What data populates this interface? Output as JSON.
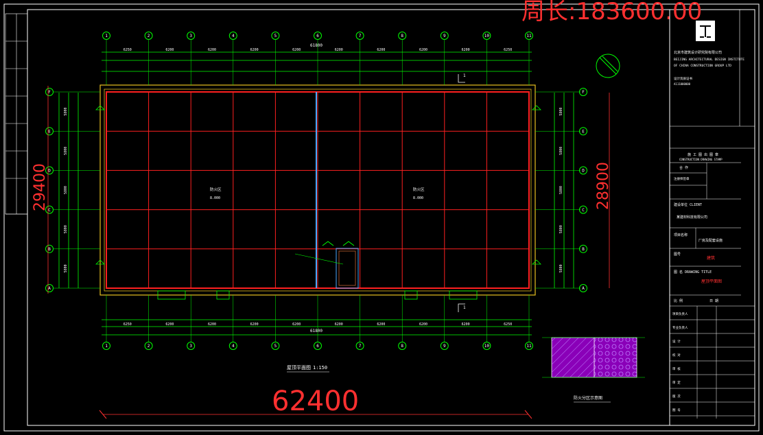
{
  "drawing": {
    "perimeter_label": "周长:183600.00",
    "overall_width": "62400",
    "left_height": "29400",
    "right_height": "28900",
    "total_span_top": "61800",
    "total_span_bottom": "61800",
    "plan_title": "屋顶平面图",
    "plan_scale": "1:150",
    "detail_title": "防火分区示意图",
    "axes_columns": [
      "1",
      "2",
      "3",
      "4",
      "5",
      "6",
      "7",
      "8",
      "9",
      "10",
      "11"
    ],
    "axes_rows": [
      "F",
      "E",
      "D",
      "C",
      "B",
      "A"
    ],
    "bay_labels_top": [
      "6250",
      "6200",
      "6200",
      "6200",
      "6200",
      "6200",
      "6200",
      "6200",
      "6200",
      "6250"
    ],
    "row_dims_left": [
      "5800",
      "5800",
      "5800",
      "5800",
      "5800"
    ],
    "row_dims_right": [
      "5800",
      "5800",
      "5800",
      "5800",
      "5800"
    ],
    "zone_label_left": "防火区",
    "zone_label_right": "防火区",
    "level_left": "8.000",
    "level_right": "8.000",
    "section_mark": "1"
  },
  "title_block": {
    "company": "北京市建筑设计研究院有限公司",
    "company_en_1": "BEIJING ARCHITECTURAL DESIGN INSTITUTE",
    "company_en_2": "OF CHINA CONSTRUCTION GROUP LTD",
    "cert": "设计资质证书",
    "cert_no": "A111000000",
    "stamp_title": "施 工 图 出 图 章",
    "stamp_en": "CONSTRUCTION DRAWING STAMP",
    "cell_a": "合 作",
    "cell_b": "注册师签章",
    "client_label": "建设单位 CLIENT",
    "client_value": "某建材科技有限公司",
    "project_label": "项目名称",
    "project_value": "厂房及配套设施",
    "drawing_no_label": "图号",
    "red_tag_1": "建筑",
    "drawing_label": "图 名 DRAWING TITLE",
    "red_tag_2": "屋顶平面图",
    "scale_label": "比 例",
    "date_label": "日 期",
    "rows": [
      "项目负责人",
      "专业负责人",
      "设 计",
      "校 对",
      "审 核",
      "审 定",
      "版 次",
      "图 号"
    ]
  },
  "colors": {
    "grid_red": "#ff2020",
    "axis_green": "#00ff00",
    "wall_yellow": "#e8c020",
    "frame_white": "#ffffff",
    "zone_purple": "#8a00b8",
    "zone_hatch": "#c080ff",
    "text_red": "#ff3030"
  }
}
